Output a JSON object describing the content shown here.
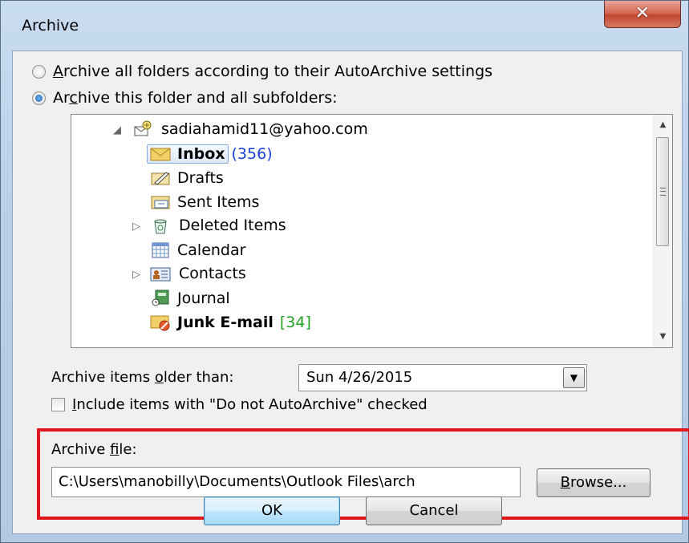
{
  "window": {
    "title": "Archive",
    "close_glyph": "✕"
  },
  "options": {
    "archive_all_prefix": "A",
    "archive_all_rest": "rchive all folders according to their AutoArchive settings",
    "archive_this_prefix": "Ar",
    "archive_this_key": "c",
    "archive_this_rest": "hive this folder and all subfolders:"
  },
  "tree": {
    "account": "sadiahamid11@yahoo.com",
    "items": [
      {
        "label": "Inbox",
        "count": "(356)",
        "icon": "inbox-icon"
      },
      {
        "label": "Drafts",
        "icon": "drafts-icon"
      },
      {
        "label": "Sent Items",
        "icon": "sent-items-icon"
      },
      {
        "label": "Deleted Items",
        "icon": "deleted-items-icon"
      },
      {
        "label": "Calendar",
        "icon": "calendar-icon"
      },
      {
        "label": "Contacts",
        "icon": "contacts-icon"
      },
      {
        "label": "Journal",
        "icon": "journal-icon"
      },
      {
        "label": "Junk E-mail",
        "count": "[34]",
        "icon": "junk-email-icon"
      }
    ]
  },
  "older_than": {
    "label_prefix": "Archive items ",
    "label_key": "o",
    "label_rest": "lder than:",
    "value": "Sun 4/26/2015"
  },
  "include": {
    "label_key": "I",
    "label_rest": "nclude items with \"Do not AutoArchive\" checked"
  },
  "archive_file": {
    "label_prefix": "Archive ",
    "label_key": "f",
    "label_rest": "ile:",
    "value": "C:\\Users\\manobilly\\Documents\\Outlook Files\\arch"
  },
  "buttons": {
    "browse_key": "B",
    "browse_rest": "rowse...",
    "ok": "OK",
    "cancel": "Cancel"
  },
  "colors": {
    "highlight": "#e0161c",
    "count_blue": "#1a3fd6",
    "count_green": "#23a023"
  }
}
